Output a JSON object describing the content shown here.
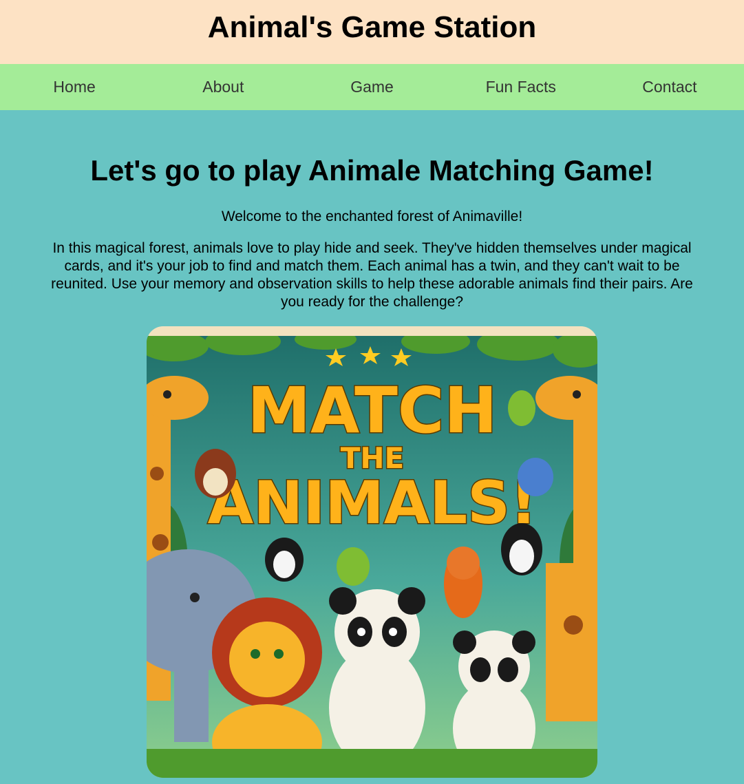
{
  "header": {
    "title": "Animal's Game Station"
  },
  "nav": {
    "items": [
      "Home",
      "About",
      "Game",
      "Fun Facts",
      "Contact"
    ]
  },
  "main": {
    "heading": "Let's go to play Animale Matching Game!",
    "welcome": "Welcome to the enchanted forest of Animaville!",
    "story": "In this magical forest, animals love to play hide and seek. They've hidden themselves under magical cards, and it's your job to find and match them. Each animal has a twin, and they can't wait to be reunited. Use your memory and observation skills to help these adorable animals find their pairs. Are you ready for the challenge?"
  },
  "poster": {
    "line1": "MATCH",
    "line2": "THE",
    "line3": "ANIMALS!"
  },
  "colors": {
    "background": "#68c4c3",
    "header": "#fde2c4",
    "nav": "#a4ec98"
  }
}
